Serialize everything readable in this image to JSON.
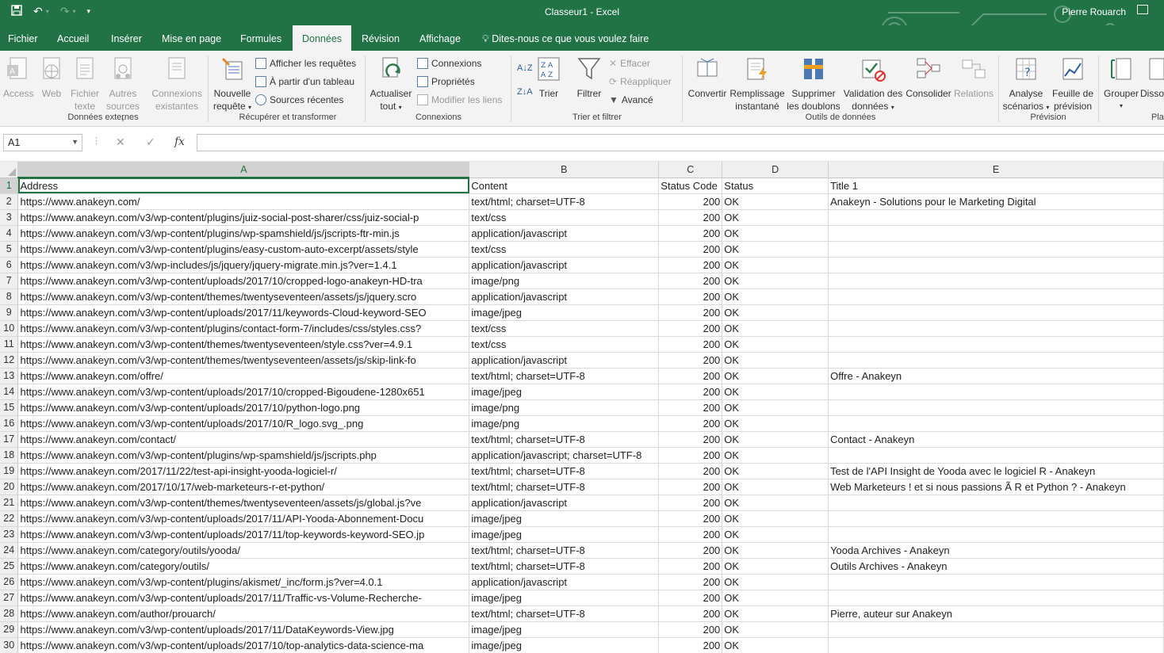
{
  "window": {
    "title": "Classeur1  -  Excel",
    "user": "Pierre Rouarch"
  },
  "tabs": [
    "Fichier",
    "Accueil",
    "Insérer",
    "Mise en page",
    "Formules",
    "Données",
    "Révision",
    "Affichage"
  ],
  "active_tab": "Données",
  "tell_me": "Dites-nous ce que vous voulez faire",
  "ribbon": {
    "external": {
      "label": "Données externes",
      "access": "Access",
      "web": "Web",
      "text_1": "Fichier",
      "text_2": "texte",
      "other_1": "Autres",
      "other_2": "sources",
      "existing_1": "Connexions",
      "existing_2": "existantes"
    },
    "get_transform": {
      "label": "Récupérer et transformer",
      "new_query_1": "Nouvelle",
      "new_query_2": "requête",
      "show_queries": "Afficher les requêtes",
      "from_table": "À partir d'un tableau",
      "recent_sources": "Sources récentes"
    },
    "connections": {
      "label": "Connexions",
      "refresh_1": "Actualiser",
      "refresh_2": "tout",
      "connections": "Connexions",
      "properties": "Propriétés",
      "edit_links": "Modifier les liens"
    },
    "sort_filter": {
      "label": "Trier et filtrer",
      "sort": "Trier",
      "filter": "Filtrer",
      "clear": "Effacer",
      "reapply": "Réappliquer",
      "advanced": "Avancé"
    },
    "data_tools": {
      "label": "Outils de données",
      "convert": "Convertir",
      "flash_fill_1": "Remplissage",
      "flash_fill_2": "instantané",
      "remove_dup_1": "Supprimer",
      "remove_dup_2": "les doublons",
      "validation_1": "Validation des",
      "validation_2": "données",
      "consolidate": "Consolider",
      "relations": "Relations"
    },
    "forecast": {
      "label": "Prévision",
      "whatif_1": "Analyse",
      "whatif_2": "scénarios",
      "sheet_1": "Feuille de",
      "sheet_2": "prévision"
    },
    "outline": {
      "label": "Pla",
      "group": "Grouper",
      "ungroup": "Disso"
    }
  },
  "formula_bar": {
    "name_box": "A1",
    "formula": ""
  },
  "grid": {
    "columns": [
      "A",
      "B",
      "C",
      "D",
      "E"
    ],
    "rows": [
      {
        "n": "1",
        "a": "Address",
        "b": "Content",
        "c": "Status Code",
        "d": "Status",
        "e": "Title 1"
      },
      {
        "n": "2",
        "a": "https://www.anakeyn.com/",
        "b": "text/html; charset=UTF-8",
        "c": "200",
        "d": "OK",
        "e": "Anakeyn - Solutions pour le Marketing Digital"
      },
      {
        "n": "3",
        "a": "https://www.anakeyn.com/v3/wp-content/plugins/juiz-social-post-sharer/css/juiz-social-p",
        "b": "text/css",
        "c": "200",
        "d": "OK",
        "e": ""
      },
      {
        "n": "4",
        "a": "https://www.anakeyn.com/v3/wp-content/plugins/wp-spamshield/js/jscripts-ftr-min.js",
        "b": "application/javascript",
        "c": "200",
        "d": "OK",
        "e": ""
      },
      {
        "n": "5",
        "a": "https://www.anakeyn.com/v3/wp-content/plugins/easy-custom-auto-excerpt/assets/style",
        "b": "text/css",
        "c": "200",
        "d": "OK",
        "e": ""
      },
      {
        "n": "6",
        "a": "https://www.anakeyn.com/v3/wp-includes/js/jquery/jquery-migrate.min.js?ver=1.4.1",
        "b": "application/javascript",
        "c": "200",
        "d": "OK",
        "e": ""
      },
      {
        "n": "7",
        "a": "https://www.anakeyn.com/v3/wp-content/uploads/2017/10/cropped-logo-anakeyn-HD-tra",
        "b": "image/png",
        "c": "200",
        "d": "OK",
        "e": ""
      },
      {
        "n": "8",
        "a": "https://www.anakeyn.com/v3/wp-content/themes/twentyseventeen/assets/js/jquery.scro",
        "b": "application/javascript",
        "c": "200",
        "d": "OK",
        "e": ""
      },
      {
        "n": "9",
        "a": "https://www.anakeyn.com/v3/wp-content/uploads/2017/11/keywords-Cloud-keyword-SEO",
        "b": "image/jpeg",
        "c": "200",
        "d": "OK",
        "e": ""
      },
      {
        "n": "10",
        "a": "https://www.anakeyn.com/v3/wp-content/plugins/contact-form-7/includes/css/styles.css?",
        "b": "text/css",
        "c": "200",
        "d": "OK",
        "e": ""
      },
      {
        "n": "11",
        "a": "https://www.anakeyn.com/v3/wp-content/themes/twentyseventeen/style.css?ver=4.9.1",
        "b": "text/css",
        "c": "200",
        "d": "OK",
        "e": ""
      },
      {
        "n": "12",
        "a": "https://www.anakeyn.com/v3/wp-content/themes/twentyseventeen/assets/js/skip-link-fo",
        "b": "application/javascript",
        "c": "200",
        "d": "OK",
        "e": ""
      },
      {
        "n": "13",
        "a": "https://www.anakeyn.com/offre/",
        "b": "text/html; charset=UTF-8",
        "c": "200",
        "d": "OK",
        "e": "Offre - Anakeyn"
      },
      {
        "n": "14",
        "a": "https://www.anakeyn.com/v3/wp-content/uploads/2017/10/cropped-Bigoudene-1280x651",
        "b": "image/jpeg",
        "c": "200",
        "d": "OK",
        "e": ""
      },
      {
        "n": "15",
        "a": "https://www.anakeyn.com/v3/wp-content/uploads/2017/10/python-logo.png",
        "b": "image/png",
        "c": "200",
        "d": "OK",
        "e": ""
      },
      {
        "n": "16",
        "a": "https://www.anakeyn.com/v3/wp-content/uploads/2017/10/R_logo.svg_.png",
        "b": "image/png",
        "c": "200",
        "d": "OK",
        "e": ""
      },
      {
        "n": "17",
        "a": "https://www.anakeyn.com/contact/",
        "b": "text/html; charset=UTF-8",
        "c": "200",
        "d": "OK",
        "e": "Contact - Anakeyn"
      },
      {
        "n": "18",
        "a": "https://www.anakeyn.com/v3/wp-content/plugins/wp-spamshield/js/jscripts.php",
        "b": "application/javascript; charset=UTF-8",
        "c": "200",
        "d": "OK",
        "e": ""
      },
      {
        "n": "19",
        "a": "https://www.anakeyn.com/2017/11/22/test-api-insight-yooda-logiciel-r/",
        "b": "text/html; charset=UTF-8",
        "c": "200",
        "d": "OK",
        "e": "Test de l'API Insight de Yooda avec le logiciel R - Anakeyn"
      },
      {
        "n": "20",
        "a": "https://www.anakeyn.com/2017/10/17/web-marketeurs-r-et-python/",
        "b": "text/html; charset=UTF-8",
        "c": "200",
        "d": "OK",
        "e": "Web Marketeurs ! et si nous passions Ã  R et Python ? - Anakeyn"
      },
      {
        "n": "21",
        "a": "https://www.anakeyn.com/v3/wp-content/themes/twentyseventeen/assets/js/global.js?ve",
        "b": "application/javascript",
        "c": "200",
        "d": "OK",
        "e": ""
      },
      {
        "n": "22",
        "a": "https://www.anakeyn.com/v3/wp-content/uploads/2017/11/API-Yooda-Abonnement-Docu",
        "b": "image/jpeg",
        "c": "200",
        "d": "OK",
        "e": ""
      },
      {
        "n": "23",
        "a": "https://www.anakeyn.com/v3/wp-content/uploads/2017/11/top-keywords-keyword-SEO.jp",
        "b": "image/jpeg",
        "c": "200",
        "d": "OK",
        "e": ""
      },
      {
        "n": "24",
        "a": "https://www.anakeyn.com/category/outils/yooda/",
        "b": "text/html; charset=UTF-8",
        "c": "200",
        "d": "OK",
        "e": "Yooda Archives - Anakeyn"
      },
      {
        "n": "25",
        "a": "https://www.anakeyn.com/category/outils/",
        "b": "text/html; charset=UTF-8",
        "c": "200",
        "d": "OK",
        "e": "Outils Archives - Anakeyn"
      },
      {
        "n": "26",
        "a": "https://www.anakeyn.com/v3/wp-content/plugins/akismet/_inc/form.js?ver=4.0.1",
        "b": "application/javascript",
        "c": "200",
        "d": "OK",
        "e": ""
      },
      {
        "n": "27",
        "a": "https://www.anakeyn.com/v3/wp-content/uploads/2017/11/Traffic-vs-Volume-Recherche-",
        "b": "image/jpeg",
        "c": "200",
        "d": "OK",
        "e": ""
      },
      {
        "n": "28",
        "a": "https://www.anakeyn.com/author/prouarch/",
        "b": "text/html; charset=UTF-8",
        "c": "200",
        "d": "OK",
        "e": "Pierre, auteur sur Anakeyn"
      },
      {
        "n": "29",
        "a": "https://www.anakeyn.com/v3/wp-content/uploads/2017/11/DataKeywords-View.jpg",
        "b": "image/jpeg",
        "c": "200",
        "d": "OK",
        "e": ""
      },
      {
        "n": "30",
        "a": "https://www.anakeyn.com/v3/wp-content/uploads/2017/10/top-analytics-data-science-ma",
        "b": "image/jpeg",
        "c": "200",
        "d": "OK",
        "e": ""
      }
    ]
  },
  "colors": {
    "excel_green": "#217346",
    "ribbon_bg": "#f3f3f3",
    "header_bg": "#efefef"
  }
}
